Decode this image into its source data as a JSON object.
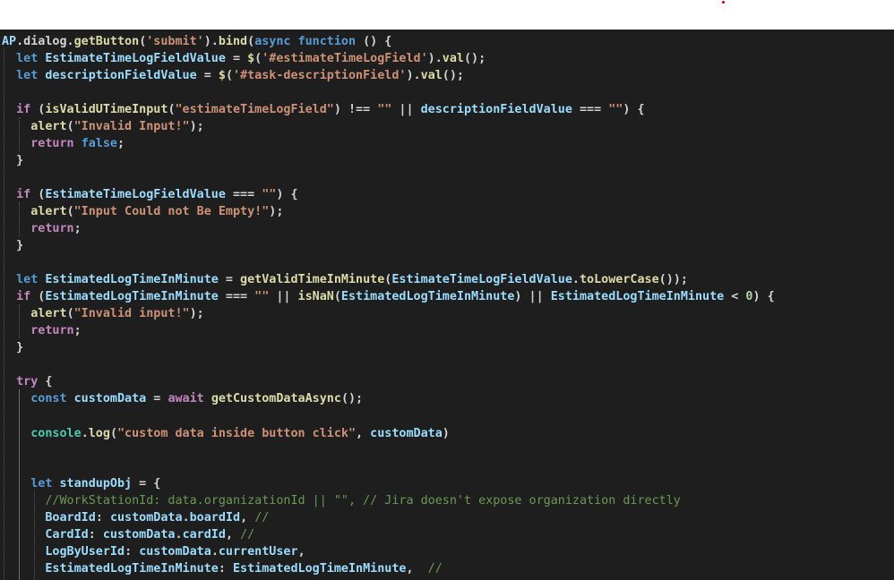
{
  "colors": {
    "editor_background": "#1e1e1e",
    "keyword": "#c586c0",
    "storage": "#569cd6",
    "function": "#dcdcaa",
    "variable": "#9cdcfe",
    "string": "#ce9178",
    "number": "#b5cea8",
    "comment": "#6a9955",
    "plain": "#d4d4d4"
  },
  "code": {
    "l1": [
      "AP",
      ".dialog.",
      "getButton",
      "(",
      "'submit'",
      ").",
      "bind",
      "(",
      "async",
      " ",
      "function",
      " () {"
    ],
    "l2": [
      "  ",
      "let",
      " ",
      "EstimateTimeLogFieldValue",
      " = ",
      "$",
      "(",
      "'#estimateTimeLogField'",
      ").",
      "val",
      "();"
    ],
    "l3": [
      "  ",
      "let",
      " ",
      "descriptionFieldValue",
      " = ",
      "$",
      "(",
      "'#task-descriptionField'",
      ").",
      "val",
      "();"
    ],
    "l4": [
      "  ",
      "if",
      " (",
      "isValidUTimeInput",
      "(",
      "\"estimateTimeLogField\"",
      ") !== ",
      "\"\"",
      " || ",
      "descriptionFieldValue",
      " === ",
      "\"\"",
      ") {"
    ],
    "l5": [
      "    ",
      "alert",
      "(",
      "\"Invalid Input!\"",
      ");"
    ],
    "l6": [
      "    ",
      "return",
      " ",
      "false",
      ";"
    ],
    "l7": [
      "  }"
    ],
    "l8": [
      "  ",
      "if",
      " (",
      "EstimateTimeLogFieldValue",
      " === ",
      "\"\"",
      ") {"
    ],
    "l9": [
      "    ",
      "alert",
      "(",
      "\"Input Could not Be Empty!\"",
      ");"
    ],
    "l10": [
      "    ",
      "return",
      ";"
    ],
    "l11": [
      "  }"
    ],
    "l12": [
      "  ",
      "let",
      " ",
      "EstimatedLogTimeInMinute",
      " = ",
      "getValidTimeInMinute",
      "(",
      "EstimateTimeLogFieldValue",
      ".",
      "toLowerCase",
      "());"
    ],
    "l13": [
      "  ",
      "if",
      " (",
      "EstimatedLogTimeInMinute",
      " === ",
      "\"\"",
      " || ",
      "isNaN",
      "(",
      "EstimatedLogTimeInMinute",
      ") || ",
      "EstimatedLogTimeInMinute",
      " < ",
      "0",
      ") {"
    ],
    "l14": [
      "    ",
      "alert",
      "(",
      "\"Invalid input!\"",
      ");"
    ],
    "l15": [
      "    ",
      "return",
      ";"
    ],
    "l16": [
      "  }"
    ],
    "l17": [
      "  ",
      "try",
      " {"
    ],
    "l18": [
      "    ",
      "const",
      " ",
      "customData",
      " = ",
      "await",
      " ",
      "getCustomDataAsync",
      "();"
    ],
    "l19": [
      "    ",
      "console",
      ".",
      "log",
      "(",
      "\"custom data inside button click\"",
      ", ",
      "customData",
      ")"
    ],
    "l20": [
      "    ",
      "let",
      " ",
      "standupObj",
      " = {"
    ],
    "l21": [
      "      ",
      "//WorkStationId: data.organizationId || \"\", // Jira doesn't expose organization directly"
    ],
    "l22": [
      "      ",
      "BoardId",
      ": ",
      "customData",
      ".",
      "boardId",
      ", ",
      "//"
    ],
    "l23": [
      "      ",
      "CardId",
      ": ",
      "customData",
      ".",
      "cardId",
      ", ",
      "//"
    ],
    "l24": [
      "      ",
      "LogByUserId",
      ": ",
      "customData",
      ".",
      "currentUser",
      ","
    ],
    "l25": [
      "      ",
      "EstimatedLogTimeInMinute",
      ": ",
      "EstimatedLogTimeInMinute",
      ",  ",
      "//"
    ]
  }
}
